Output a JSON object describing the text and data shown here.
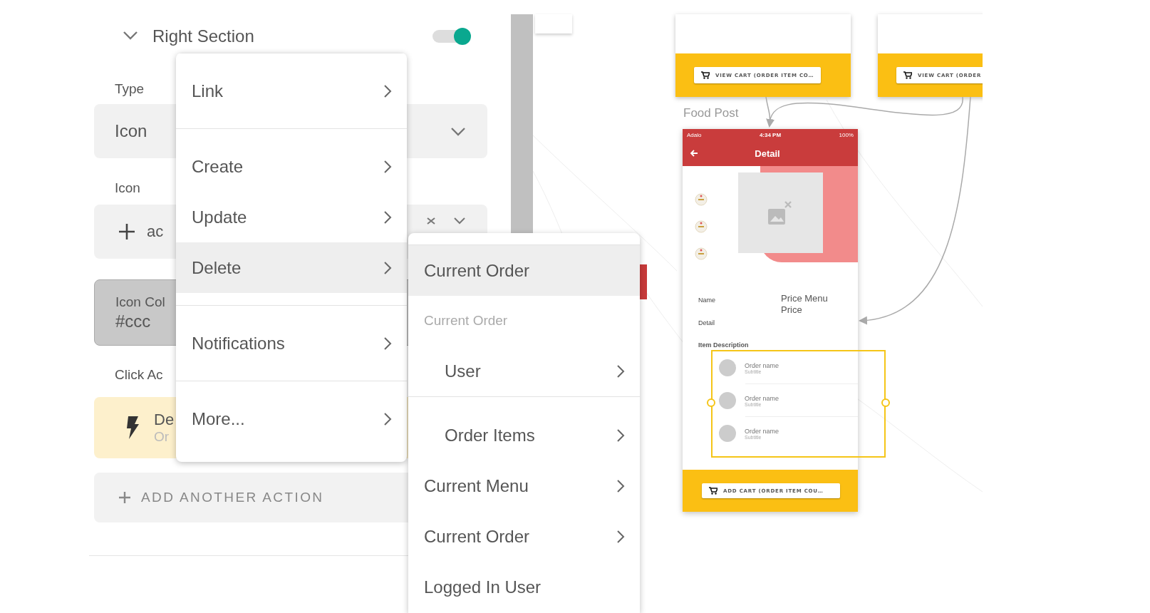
{
  "panel": {
    "title": "Right Section",
    "expanded": true,
    "enabled": true
  },
  "fields": [
    {
      "kind": "dropdown",
      "label": "Type",
      "value": "Icon"
    },
    {
      "kind": "icon",
      "label": "Icon",
      "value": "ac"
    },
    {
      "kind": "color",
      "label": "Icon Col",
      "value": "#ccc"
    }
  ],
  "click_actions": {
    "label": "Click Ac",
    "actions": [
      {
        "title": "De",
        "subtitle": "Or"
      }
    ],
    "add_button": "ADD ANOTHER ACTION"
  },
  "menu": {
    "groups": [
      {
        "items": [
          {
            "label": "Link",
            "selected": false
          }
        ]
      },
      {
        "items": [
          {
            "label": "Create",
            "selected": false
          },
          {
            "label": "Update",
            "selected": false
          },
          {
            "label": "Delete",
            "selected": true
          }
        ]
      },
      {
        "items": [
          {
            "label": "Notifications",
            "selected": false
          }
        ]
      },
      {
        "items": [
          {
            "label": "More...",
            "selected": false
          }
        ]
      }
    ]
  },
  "submenu": {
    "groups": [
      {
        "items": [
          {
            "kind": "item",
            "label": "Current Order",
            "selected": true,
            "has_submenu": false
          },
          {
            "kind": "header",
            "label": "Current Order"
          },
          {
            "kind": "nested",
            "label": "User",
            "selected": false,
            "has_submenu": true
          }
        ]
      },
      {
        "items": [
          {
            "kind": "nested",
            "label": "Order Items",
            "selected": false,
            "has_submenu": true
          },
          {
            "kind": "item",
            "label": "Current Menu",
            "selected": false,
            "has_submenu": true
          },
          {
            "kind": "item",
            "label": "Current Order",
            "selected": false,
            "has_submenu": true
          },
          {
            "kind": "item",
            "label": "Logged In User",
            "selected": false,
            "has_submenu": false
          }
        ]
      }
    ]
  },
  "canvas": {
    "screens": [
      {
        "button": "VIEW CART (ORDER ITEM CO…"
      },
      {
        "button": "VIEW CART (ORDER"
      }
    ],
    "detail_screen": {
      "title": "Food Post",
      "status": {
        "carrier": "Adalo",
        "time": "4:34 PM",
        "battery": "100%"
      },
      "header": "Detail",
      "labels": [
        "Name",
        "Detail"
      ],
      "price": "Price Menu Price",
      "list_title": "Item Description",
      "list": {
        "selected": true,
        "rows": [
          {
            "title": "Order name",
            "subtitle": "Subtitle"
          },
          {
            "title": "Order name",
            "subtitle": "Subtitle"
          },
          {
            "title": "Order name",
            "subtitle": "Subtitle"
          }
        ]
      },
      "button": "ADD CART (ORDER ITEM COU…"
    }
  }
}
